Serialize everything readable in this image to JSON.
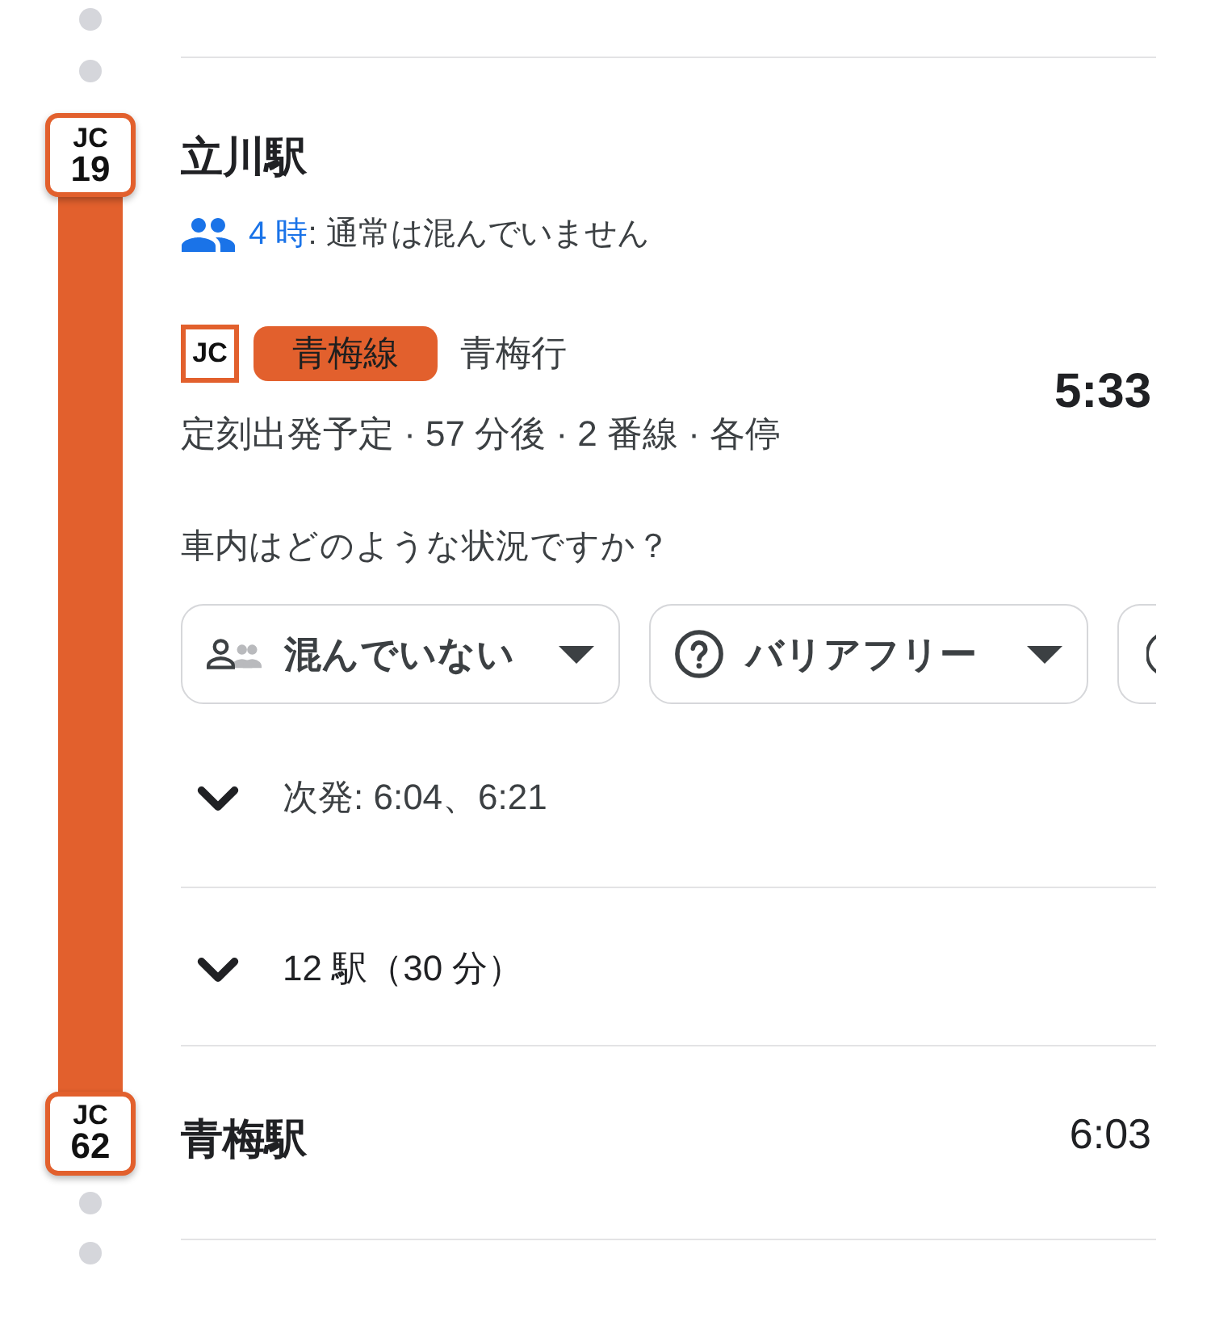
{
  "departure": {
    "line_code": "JC",
    "station_number": "19",
    "name": "立川駅",
    "crowd_hour": "4 時",
    "crowd_status": ": 通常は混んでいません"
  },
  "service": {
    "line_code": "JC",
    "line_name": "青梅線",
    "destination": "青梅行",
    "departure_time": "5:33",
    "details": "定刻出発予定 · 57 分後 · 2 番線 · 各停"
  },
  "feedback": {
    "question": "車内はどのような状況ですか？",
    "chips": [
      {
        "kind": "crowding",
        "label": "混んでいない"
      },
      {
        "kind": "accessibility",
        "label": "バリアフリー"
      },
      {
        "kind": "cut_off"
      }
    ]
  },
  "next_departures": {
    "expanded": false,
    "text": "次発: 6:04、6:21"
  },
  "stops": {
    "expanded": false,
    "text": "12 駅（30 分）"
  },
  "arrival": {
    "line_code": "JC",
    "station_number": "62",
    "name": "青梅駅",
    "arrival_time": "6:03"
  }
}
